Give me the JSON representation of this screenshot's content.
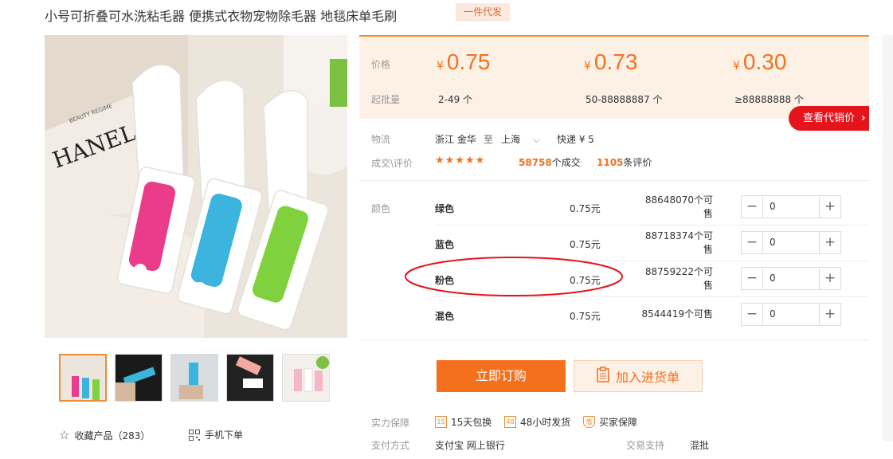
{
  "product": {
    "title": "小号可折叠可水洗粘毛器 便携式衣物宠物除毛器 地毯床单毛刷",
    "tag": "一件代发"
  },
  "price_panel": {
    "price_label": "价格",
    "moq_label": "起批量",
    "currency": "¥",
    "tiers": [
      {
        "price": "0.75",
        "qty": "2-49 个"
      },
      {
        "price": "0.73",
        "qty": "50-88888887 个"
      },
      {
        "price": "0.30",
        "qty": "≥88888888 个"
      }
    ],
    "dist_button": "查看代销价",
    "dist_arrow": "›"
  },
  "logistics": {
    "label": "物流",
    "from": "浙江 金华",
    "to_word": "至",
    "to": "上海",
    "express": "快递 ¥ 5"
  },
  "deals": {
    "label": "成交\\评价",
    "stars": "★★★★★",
    "count": "58758",
    "count_suffix": "个成交",
    "reviews": "1105",
    "reviews_suffix": "条评价"
  },
  "colors": {
    "label": "颜色",
    "items": [
      {
        "name": "绿色",
        "price": "0.75元",
        "stock": "88648070个可售",
        "qty": "0"
      },
      {
        "name": "蓝色",
        "price": "0.75元",
        "stock": "88718374个可售",
        "qty": "0"
      },
      {
        "name": "粉色",
        "price": "0.75元",
        "stock": "88759222个可售",
        "qty": "0"
      },
      {
        "name": "混色",
        "price": "0.75元",
        "stock": "8544419个可售",
        "qty": "0"
      }
    ],
    "minus": "−",
    "plus": "+"
  },
  "actions": {
    "buy": "立即订购",
    "cart": "加入进货单"
  },
  "guarantee": {
    "label": "实力保障",
    "items": [
      {
        "icon": "15",
        "text": "15天包换"
      },
      {
        "icon": "48",
        "text": "48小时发货"
      },
      {
        "icon": "盾",
        "text": "买家保障"
      }
    ]
  },
  "payment": {
    "label": "支付方式",
    "methods": "支付宝 网上银行",
    "trade_label": "交易支持",
    "trade_value": "混批"
  },
  "left_bottom": {
    "favorite": "收藏产品（283）",
    "mobile": "手机下单"
  },
  "main_image": {
    "brand_text": "HANEL",
    "small_text": "BEAUTY REGIME"
  },
  "highlight_color": "#e5141c",
  "accent_color": "#f5701d"
}
